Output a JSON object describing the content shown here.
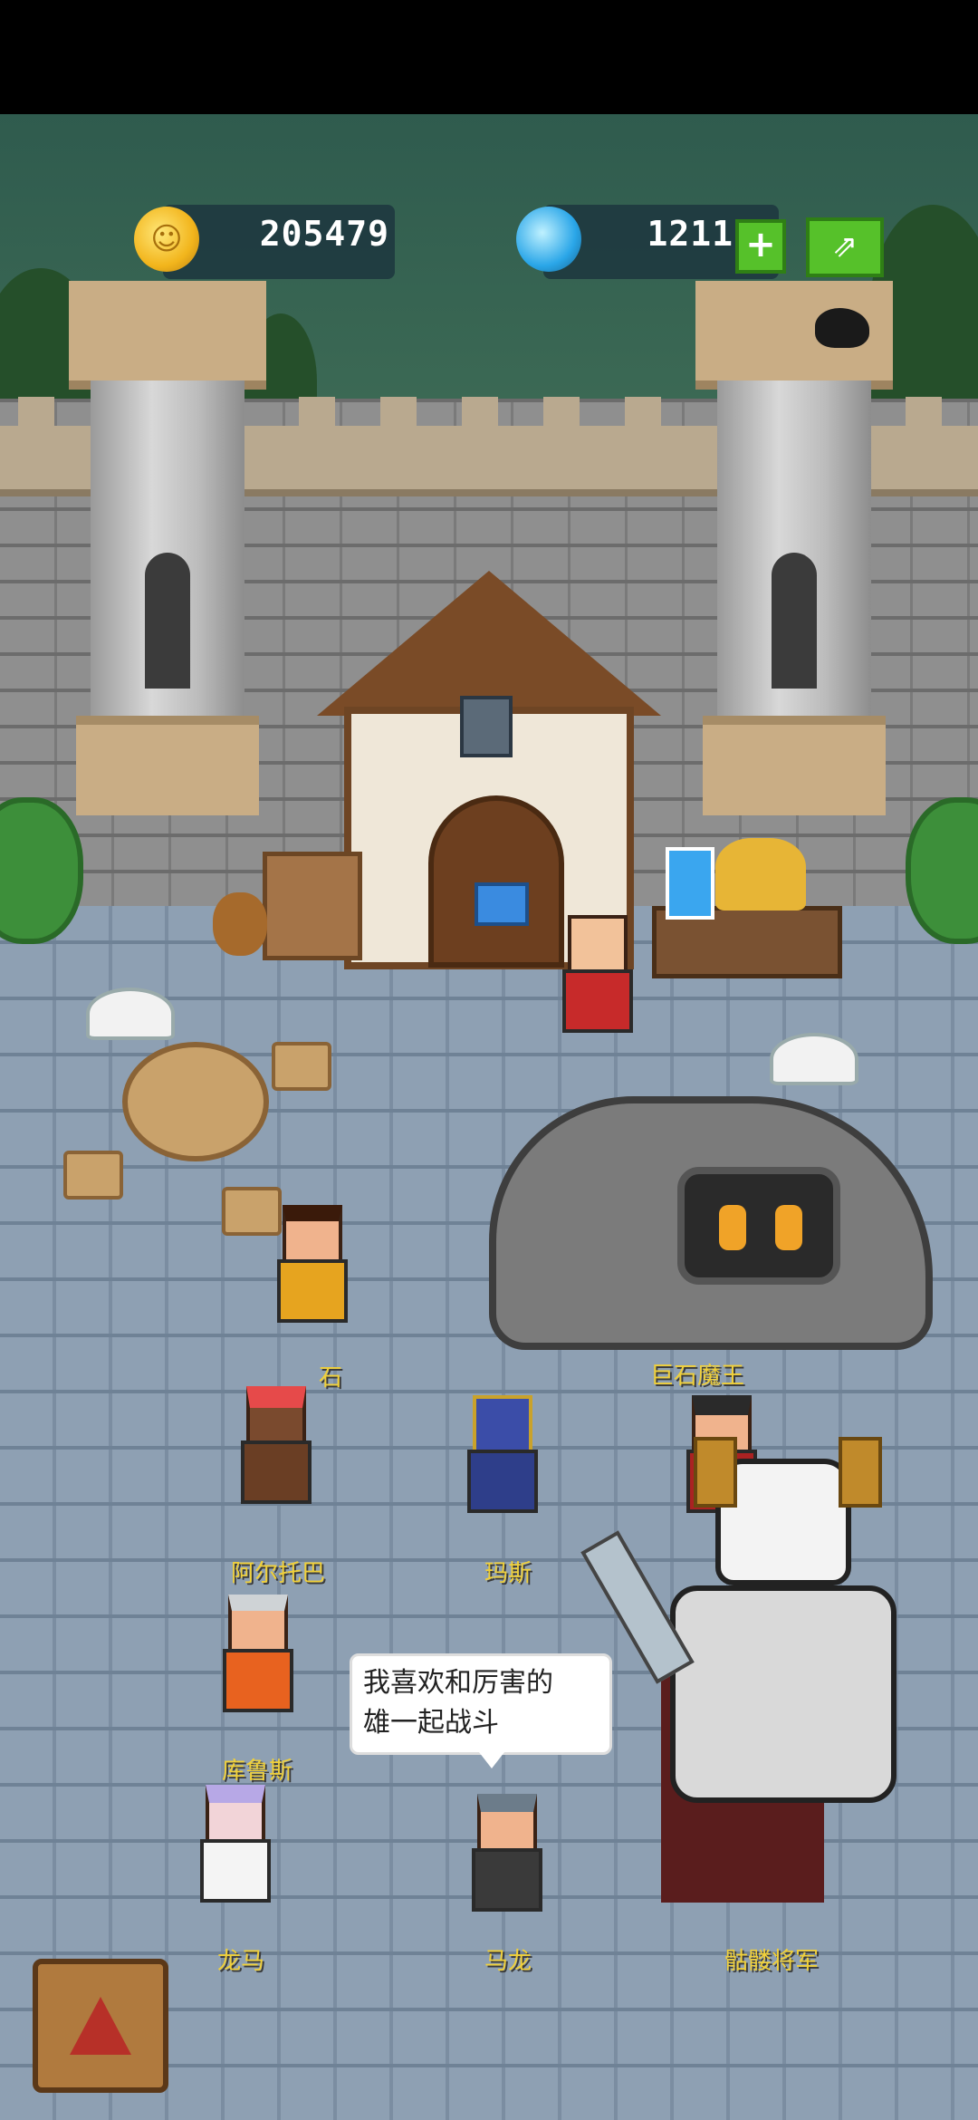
{
  "hud": {
    "coins": "205479",
    "gems": "1211",
    "plus_label": "+",
    "share_label": "⇗",
    "coin_symbol": "☺"
  },
  "speech_bubble": {
    "line1": "我喜欢和厉害的",
    "line2": "雄一起战斗"
  },
  "heroes": [
    {
      "name": "石"
    },
    {
      "name": "阿尔托巴"
    },
    {
      "name": "玛斯"
    },
    {
      "name": "库鲁斯"
    },
    {
      "name": "龙马"
    },
    {
      "name": "马龙"
    }
  ],
  "bosses": [
    {
      "name": "巨石魔王"
    },
    {
      "name": "骷髅将军"
    }
  ],
  "colors": {
    "name_label": "#f0d03a",
    "plus_button": "#56c12a",
    "coin": "#f2b51c",
    "gem": "#2aa6e8"
  },
  "icons": [
    "coin-icon",
    "gem-icon",
    "plus-icon",
    "share-icon",
    "back-icon"
  ]
}
